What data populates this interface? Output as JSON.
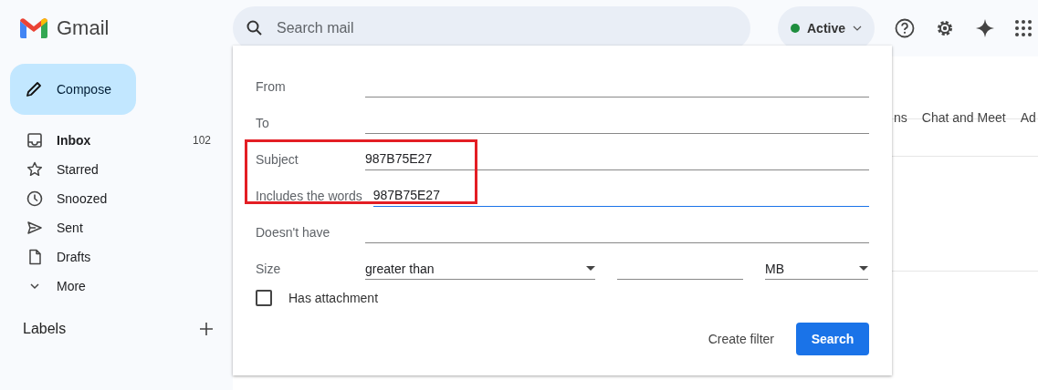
{
  "app": {
    "name": "Gmail"
  },
  "compose": {
    "label": "Compose"
  },
  "nav": [
    {
      "label": "Inbox",
      "count": "102",
      "unread": true
    },
    {
      "label": "Starred",
      "unread": false
    },
    {
      "label": "Snoozed",
      "unread": false
    },
    {
      "label": "Sent",
      "unread": false
    },
    {
      "label": "Drafts",
      "unread": false
    },
    {
      "label": "More",
      "unread": false
    }
  ],
  "labels": {
    "heading": "Labels"
  },
  "search": {
    "placeholder": "Search mail"
  },
  "status": {
    "label": "Active",
    "color": "#1e8e3e"
  },
  "background_tabs": [
    "ns",
    "Chat and Meet",
    "Ad"
  ],
  "search_panel": {
    "fields": [
      {
        "label": "From",
        "focused": false
      },
      {
        "label": "To",
        "focused": false
      },
      {
        "label": "Subject",
        "value": "987B75E27",
        "focused": false
      },
      {
        "label": "Includes the words",
        "value": "987B75E27",
        "focused": true
      },
      {
        "label": "Doesn't have",
        "focused": false
      }
    ],
    "size": {
      "label": "Size",
      "comparison": "greater than",
      "unit": "MB"
    },
    "has_attachment": {
      "label": "Has attachment",
      "checked": false
    },
    "create_filter": "Create filter",
    "search_button": "Search"
  }
}
